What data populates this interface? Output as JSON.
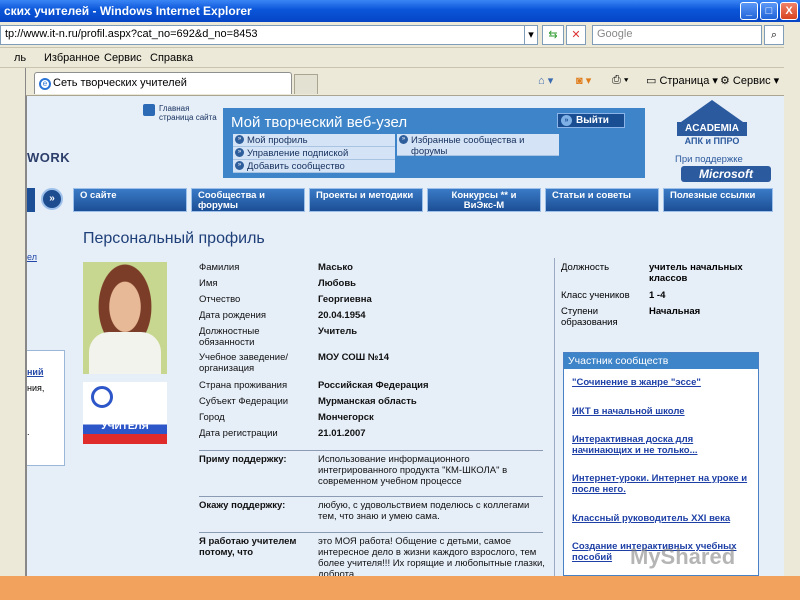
{
  "window": {
    "title": "ских учителей - Windows Internet Explorer",
    "controls": [
      "_",
      "□",
      "X"
    ]
  },
  "address": {
    "url": "tp://www.it-n.ru/profil.aspx?cat_no=692&d_no=8453",
    "search_placeholder": "Google"
  },
  "menu": [
    "ль",
    "Избранное",
    "Сервис",
    "Справка"
  ],
  "tab": {
    "label": "Сеть творческих учителей"
  },
  "toolbar": {
    "page_label": "Страница",
    "service_label": "Сервис"
  },
  "site": {
    "logo_fragment": "WORK",
    "home_link": [
      "Главная",
      "страница сайта"
    ],
    "webnode_title": "Мой творческий веб-узел",
    "exit_label": "Выйти",
    "webnode_links": [
      "Мой профиль",
      "Управление подпиской",
      "Добавить сообщество"
    ],
    "webnode_right_link": "Избранные сообщества и форумы",
    "academia": {
      "name": "ACADEMIA",
      "sub": "АПК и ППРО"
    },
    "support_text": "При поддержке",
    "microsoft": "Microsoft"
  },
  "nav": [
    "О сайте",
    "Сообщества и форумы",
    "Проекты и методики",
    "Конкурсы ** и ВиЭкс-М",
    "Статьи и советы",
    "Полезные ссылки"
  ],
  "left_column": {
    "link_top": "ел",
    "box_lines": [
      "ний",
      "ния,",
      "."
    ]
  },
  "profile": {
    "title": "Персональный профиль",
    "badge_text": "ЛУЧШИЕ УЧИТЕЛЯ",
    "fields": [
      {
        "key": "Фамилия",
        "value": "Масько"
      },
      {
        "key": "Имя",
        "value": "Любовь"
      },
      {
        "key": "Отчество",
        "value": "Георгиевна"
      },
      {
        "key": "Дата рождения",
        "value": "20.04.1954"
      },
      {
        "key": "Должностные обязанности",
        "value": "Учитель"
      },
      {
        "key": "Учебное заведение/организация",
        "value": "МОУ СОШ №14"
      },
      {
        "key": "Страна проживания",
        "value": "Российская Федерация"
      },
      {
        "key": "Субъект Федерации",
        "value": "Мурманская область"
      },
      {
        "key": "Город",
        "value": "Мончегорск"
      },
      {
        "key": "Дата регистрации",
        "value": "21.01.2007"
      }
    ],
    "support": [
      {
        "key": "Приму поддержку:",
        "value": "Использование информационного интегрированного продукта \"КМ-ШКОЛА\" в современном учебном процессе"
      },
      {
        "key": "Окажу поддержку:",
        "value": "любую, с удовольствием поделюсь с коллегами тем, что знаю и умею сама."
      },
      {
        "key": "Я работаю учителем потому, что",
        "value": "это МОЯ работа! Общение с детьми, самое интересное дело в жизни каждого взрослого, тем более учителя!!! Их горящие и любопытные глазки, доброта,"
      }
    ],
    "right_fields": [
      {
        "key": "Должность",
        "value": "учитель начальных классов"
      },
      {
        "key": "Класс учеников",
        "value": "1 -4"
      },
      {
        "key": "Ступени образования",
        "value": "Начальная"
      }
    ]
  },
  "communities": {
    "title": "Участник сообществ",
    "items": [
      "\"Сочинение в жанре \"эссе\"",
      "ИКТ в начальной школе",
      "Интерактивная доска для начинающих и не только...",
      "Интернет-уроки. Интернет на уроке и после него.",
      "Классный руководитель XXI века",
      "Создание интерактивных учебных пособий"
    ]
  },
  "watermark": "MyShared"
}
